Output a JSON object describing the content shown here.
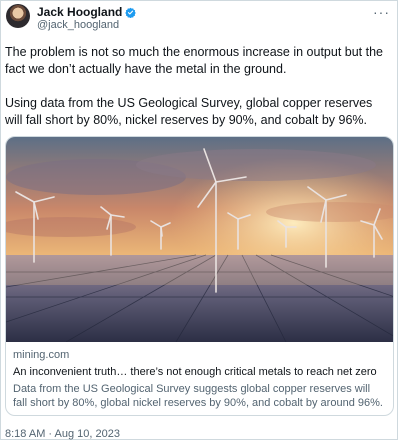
{
  "author": {
    "name": "Jack Hoogland",
    "handle": "@jack_hoogland",
    "verified_icon": "verified-badge-icon"
  },
  "menu_icon": "more-options-icon",
  "tweet": {
    "paragraph1": "The problem is not so much the enormous increase in output but the fact we don’t actually have the metal in the ground.",
    "paragraph2": "Using data from the US Geological Survey, global copper reserves will fall short by 80%, nickel reserves by 90%, and cobalt by 96%."
  },
  "link_card": {
    "domain": "mining.com",
    "title": "An inconvenient truth… there’s not enough critical metals to reach net zero",
    "description": "Data from the US Geological Survey suggests global copper reserves will fall short by 80%, global nickel reserves by 90%, and cobalt by around 96%.",
    "image_icon": "wind-turbines-solar-panels-sunset-image"
  },
  "timestamp": "8:18 AM · Aug 10, 2023",
  "colors": {
    "accent": "#1d9bf0",
    "text_primary": "#0f1419",
    "text_secondary": "#536471",
    "border": "#cfd9de"
  }
}
